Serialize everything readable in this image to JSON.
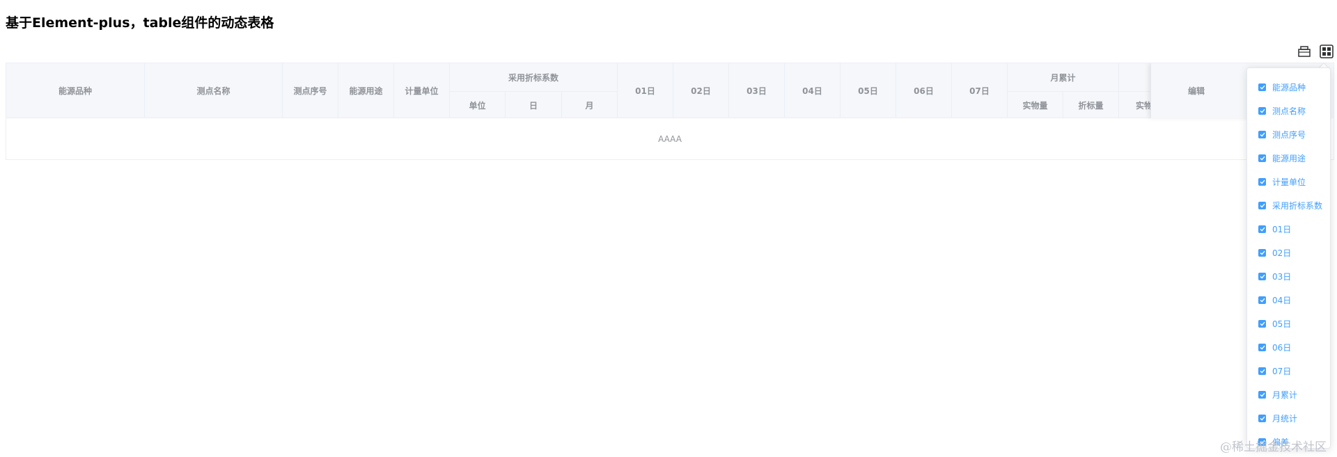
{
  "page": {
    "title": "基于Element-plus，table组件的动态表格"
  },
  "toolbar": {
    "icons": [
      "print-icon",
      "column-settings-icon"
    ]
  },
  "table": {
    "headers": {
      "energy_type": "能源品种",
      "point_name": "测点名称",
      "point_seq": "测点序号",
      "energy_use": "能源用途",
      "unit": "计量单位",
      "coef_group": "采用折标系数",
      "coef_unit": "单位",
      "coef_day": "日",
      "coef_month": "月",
      "d01": "01日",
      "d02": "02日",
      "d03": "03日",
      "d04": "04日",
      "d05": "05日",
      "d06": "06日",
      "d07": "07日",
      "month_total": "月累计",
      "physical_qty": "实物量",
      "standard_qty": "折标量",
      "physical_qty_2": "实物",
      "edit": "编辑"
    },
    "empty_text": "AAAA"
  },
  "column_settings": {
    "items": [
      {
        "label": "能源品种",
        "checked": true
      },
      {
        "label": "测点名称",
        "checked": true
      },
      {
        "label": "测点序号",
        "checked": true
      },
      {
        "label": "能源用途",
        "checked": true
      },
      {
        "label": "计量单位",
        "checked": true
      },
      {
        "label": "采用折标系数",
        "checked": true
      },
      {
        "label": "01日",
        "checked": true
      },
      {
        "label": "02日",
        "checked": true
      },
      {
        "label": "03日",
        "checked": true
      },
      {
        "label": "04日",
        "checked": true
      },
      {
        "label": "05日",
        "checked": true
      },
      {
        "label": "06日",
        "checked": true
      },
      {
        "label": "07日",
        "checked": true
      },
      {
        "label": "月累计",
        "checked": true
      },
      {
        "label": "月统计",
        "checked": true
      },
      {
        "label": "偏差",
        "checked": true
      }
    ]
  },
  "watermark": "@稀土掘金技术社区",
  "colors": {
    "accent": "#409eff",
    "header_bg": "#f5f7fa",
    "border": "#ebeef5",
    "header_text": "#909399"
  }
}
